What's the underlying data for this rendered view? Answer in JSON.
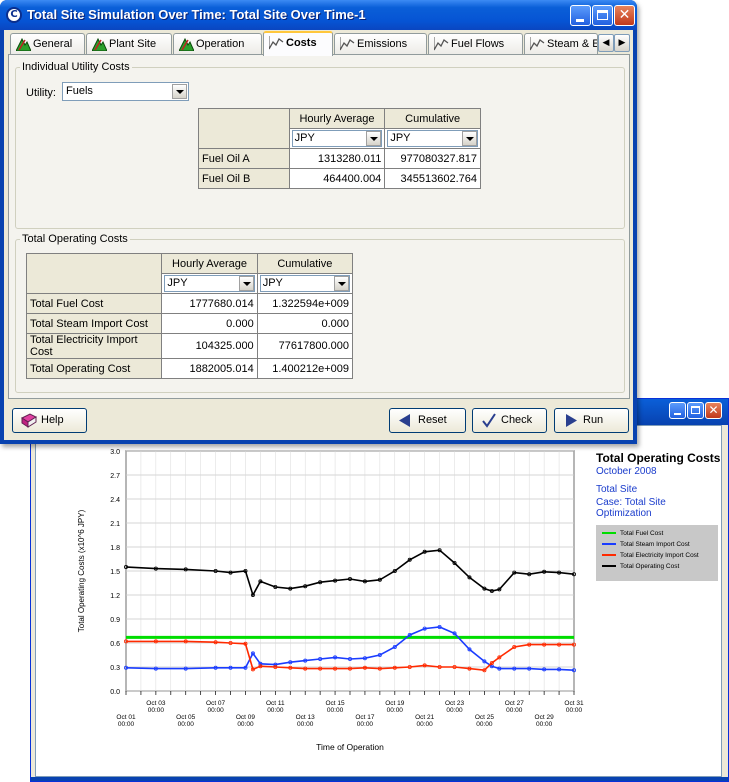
{
  "dialog": {
    "title": "Total Site Simulation Over Time: Total Site Over Time-1",
    "tabs": [
      {
        "label": "General"
      },
      {
        "label": "Plant Site"
      },
      {
        "label": "Operation"
      },
      {
        "label": "Costs"
      },
      {
        "label": "Emissions"
      },
      {
        "label": "Fuel Flows"
      },
      {
        "label": "Steam & E"
      }
    ],
    "active_tab": "Costs",
    "individual": {
      "group_label": "Individual Utility Costs",
      "utility_label": "Utility:",
      "utility_value": "Fuels",
      "col_headers": [
        "Hourly Average",
        "Cumulative"
      ],
      "units": [
        "JPY",
        "JPY"
      ],
      "rows": [
        {
          "name": "Fuel Oil A",
          "hourly": "1313280.011",
          "cumulative": "977080327.817"
        },
        {
          "name": "Fuel Oil B",
          "hourly": "464400.004",
          "cumulative": "345513602.764"
        }
      ]
    },
    "total": {
      "group_label": "Total Operating Costs",
      "col_headers": [
        "Hourly Average",
        "Cumulative"
      ],
      "units": [
        "JPY",
        "JPY"
      ],
      "rows": [
        {
          "name": "Total Fuel Cost",
          "hourly": "1777680.014",
          "cumulative": "1.322594e+009"
        },
        {
          "name": "Total Steam Import Cost",
          "hourly": "0.000",
          "cumulative": "0.000"
        },
        {
          "name": "Total Electricity Import Cost",
          "hourly": "104325.000",
          "cumulative": "77617800.000"
        },
        {
          "name": "Total Operating Cost",
          "hourly": "1882005.014",
          "cumulative": "1.400212e+009"
        }
      ]
    },
    "buttons": {
      "help": "Help",
      "reset": "Reset",
      "check": "Check",
      "run": "Run"
    }
  },
  "chart_window": {
    "title": "Total Operating Costs",
    "subtitle": "October 2008",
    "site": "Total Site",
    "case": "Case: Total Site Optimization"
  },
  "chart_data": {
    "type": "line",
    "xlabel": "Time of Operation",
    "ylabel": "Total Operating Costs (x10^6 JPY)",
    "ylim": [
      0,
      3.0
    ],
    "xlim": [
      "Oct 01 00:00",
      "Oct 31 00:00"
    ],
    "y_ticks": [
      "0.0",
      "0.3",
      "0.6",
      "0.9",
      "1.2",
      "1.5",
      "1.8",
      "2.1",
      "2.4",
      "2.7",
      "3.0"
    ],
    "x_ticks_lower": [
      "Oct 01\n00:00",
      "Oct 05\n00:00",
      "Oct 09\n00:00",
      "Oct 13\n00:00",
      "Oct 17\n00:00",
      "Oct 21\n00:00",
      "Oct 25\n00:00",
      "Oct 29\n00:00"
    ],
    "x_ticks_upper": [
      "Oct 03\n00:00",
      "Oct 07\n00:00",
      "Oct 11\n00:00",
      "Oct 15\n00:00",
      "Oct 19\n00:00",
      "Oct 23\n00:00",
      "Oct 27\n00:00",
      "Oct 31\n00:00"
    ],
    "grid": true,
    "legend_position": "right",
    "x": [
      1,
      3,
      5,
      7,
      8,
      9,
      9.5,
      10,
      11,
      12,
      13,
      14,
      15,
      16,
      17,
      18,
      19,
      20,
      21,
      22,
      23,
      24,
      25,
      25.5,
      26,
      27,
      28,
      29,
      30,
      31
    ],
    "series": [
      {
        "name": "Total Fuel Cost",
        "color": "#00dd00",
        "values": [
          0.67,
          0.67,
          0.67,
          0.67,
          0.67,
          0.67,
          0.67,
          0.67,
          0.67,
          0.67,
          0.67,
          0.67,
          0.67,
          0.67,
          0.67,
          0.67,
          0.67,
          0.67,
          0.67,
          0.67,
          0.67,
          0.67,
          0.67,
          0.67,
          0.67,
          0.67,
          0.67,
          0.67,
          0.67,
          0.67
        ]
      },
      {
        "name": "Total Steam Import Cost",
        "color": "#1a3cff",
        "values": [
          0.29,
          0.28,
          0.28,
          0.29,
          0.29,
          0.29,
          0.47,
          0.34,
          0.33,
          0.36,
          0.38,
          0.4,
          0.42,
          0.4,
          0.41,
          0.45,
          0.55,
          0.7,
          0.78,
          0.8,
          0.72,
          0.52,
          0.37,
          0.31,
          0.28,
          0.28,
          0.28,
          0.27,
          0.27,
          0.26
        ]
      },
      {
        "name": "Total Electricity Import Cost",
        "color": "#ff2a00",
        "values": [
          0.62,
          0.62,
          0.62,
          0.61,
          0.6,
          0.59,
          0.27,
          0.31,
          0.3,
          0.29,
          0.28,
          0.28,
          0.28,
          0.28,
          0.29,
          0.28,
          0.29,
          0.3,
          0.32,
          0.3,
          0.3,
          0.28,
          0.26,
          0.35,
          0.42,
          0.55,
          0.58,
          0.58,
          0.58,
          0.58
        ]
      },
      {
        "name": "Total Operating Cost",
        "color": "#000000",
        "values": [
          1.55,
          1.53,
          1.52,
          1.5,
          1.48,
          1.5,
          1.2,
          1.37,
          1.3,
          1.28,
          1.31,
          1.36,
          1.38,
          1.4,
          1.37,
          1.39,
          1.5,
          1.64,
          1.74,
          1.76,
          1.6,
          1.42,
          1.28,
          1.25,
          1.27,
          1.48,
          1.46,
          1.49,
          1.48,
          1.46
        ]
      }
    ]
  }
}
